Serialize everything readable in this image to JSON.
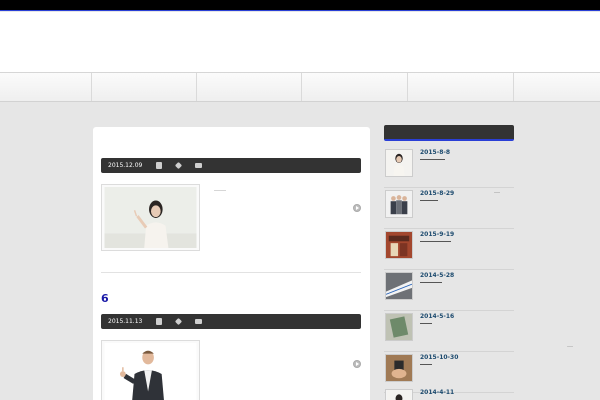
{
  "nav": {
    "items": [
      "",
      "",
      "",
      "",
      "",
      ""
    ]
  },
  "posts": [
    {
      "date": "2015.12.09",
      "title": "",
      "excerpt": "……",
      "image": "woman-pointing-photo"
    },
    {
      "date": "2015.11.13",
      "title": "6",
      "excerpt": "",
      "image": "man-thumbs-up-photo"
    }
  ],
  "icons": {
    "doc": "document-icon",
    "tag": "tag-icon",
    "comment": "comment-icon",
    "more": "arrow-circle-icon"
  },
  "sidebar": {
    "heading": "",
    "items": [
      {
        "date": "2015-8-8",
        "extra": ""
      },
      {
        "date": "2015-8-29",
        "extra": "…"
      },
      {
        "date": "2015-9-19",
        "extra": ""
      },
      {
        "date": "2014-5-28",
        "extra": ""
      },
      {
        "date": "2014-5-16",
        "extra": ""
      },
      {
        "date": "2015-10-30",
        "extra": ""
      },
      {
        "date": "2014-4-11",
        "extra": ""
      }
    ]
  },
  "pager": {
    "dots": "…"
  },
  "colors": {
    "accent": "#2a3fd6",
    "title": "#1a1aa8",
    "bar": "#333333"
  }
}
